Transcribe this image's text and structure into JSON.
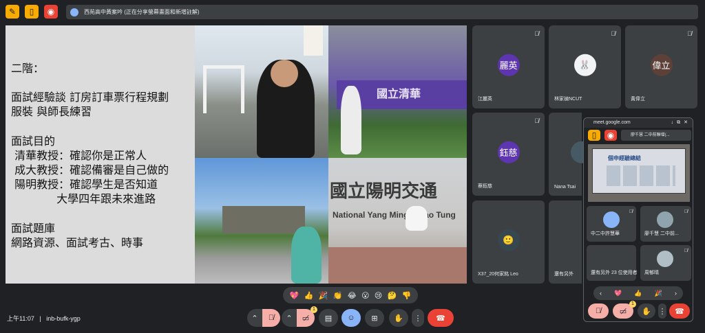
{
  "topbar": {
    "share_banner": "西苑高中黃案吟 (正在分享螢幕畫面和新增註解)"
  },
  "slide": {
    "lines": [
      "二階：",
      "面試經驗談 訂房訂車票行程規劃",
      "服裝 與師長練習",
      "面試目的",
      " 清華教授：確認你是正常人",
      " 成大教授：確認備審是自己做的",
      " 陽明教授：確認學生是否知道",
      "             大學四年跟未來進路",
      "面試題庫",
      "網路資源、面試考古、時事"
    ],
    "photo_sign_1": "國立陽明交通",
    "photo_sign_2": "National Yang Ming Chiao Tung",
    "photo_sign_3": "國立清華"
  },
  "participants": [
    {
      "avatar_text": "麗英",
      "name": "江麗英",
      "color": "#5e35b1"
    },
    {
      "avatar_text": "",
      "name": "林家禎NCUT",
      "color": "#f1f3f4"
    },
    {
      "avatar_text": "偉立",
      "name": "黃偉立",
      "color": "#5d4037"
    },
    {
      "avatar_text": "鈺慈",
      "name": "蔡鈺慈",
      "color": "#5e35b1"
    },
    {
      "avatar_text": "",
      "name": "Nana Tsai",
      "color": "#455a64"
    },
    {
      "avatar_text": "",
      "name": "X37_20何家銘 Leo",
      "color": "#37474f"
    },
    {
      "avatar_text": "",
      "name": "還有另外",
      "color": "#455a64"
    }
  ],
  "pip": {
    "url": "meet.google.com",
    "share_label": "廖千慧 二中前聯增(...",
    "slide_title": "個申經驗總結",
    "tiles": [
      {
        "name": "中二中許慧華"
      },
      {
        "name": "廖千慧 二中前..."
      },
      {
        "name": "還有另外 23 位使用者"
      },
      {
        "name": "周郁晴"
      }
    ],
    "badge_count": "1"
  },
  "bottombar": {
    "time": "上午11:07",
    "separator": "|",
    "meeting_code": "inb-bufk-ygp",
    "badge_count": "1"
  },
  "reactions": [
    "💖",
    "👍",
    "🎉",
    "👏",
    "😂",
    "😮",
    "😢",
    "🤔",
    "👎"
  ],
  "colors": {
    "background": "#202124",
    "tile": "#3c4043",
    "end_call": "#ea4335",
    "accent_blue": "#8ab4f8",
    "accent_pink": "#f6aea9"
  }
}
